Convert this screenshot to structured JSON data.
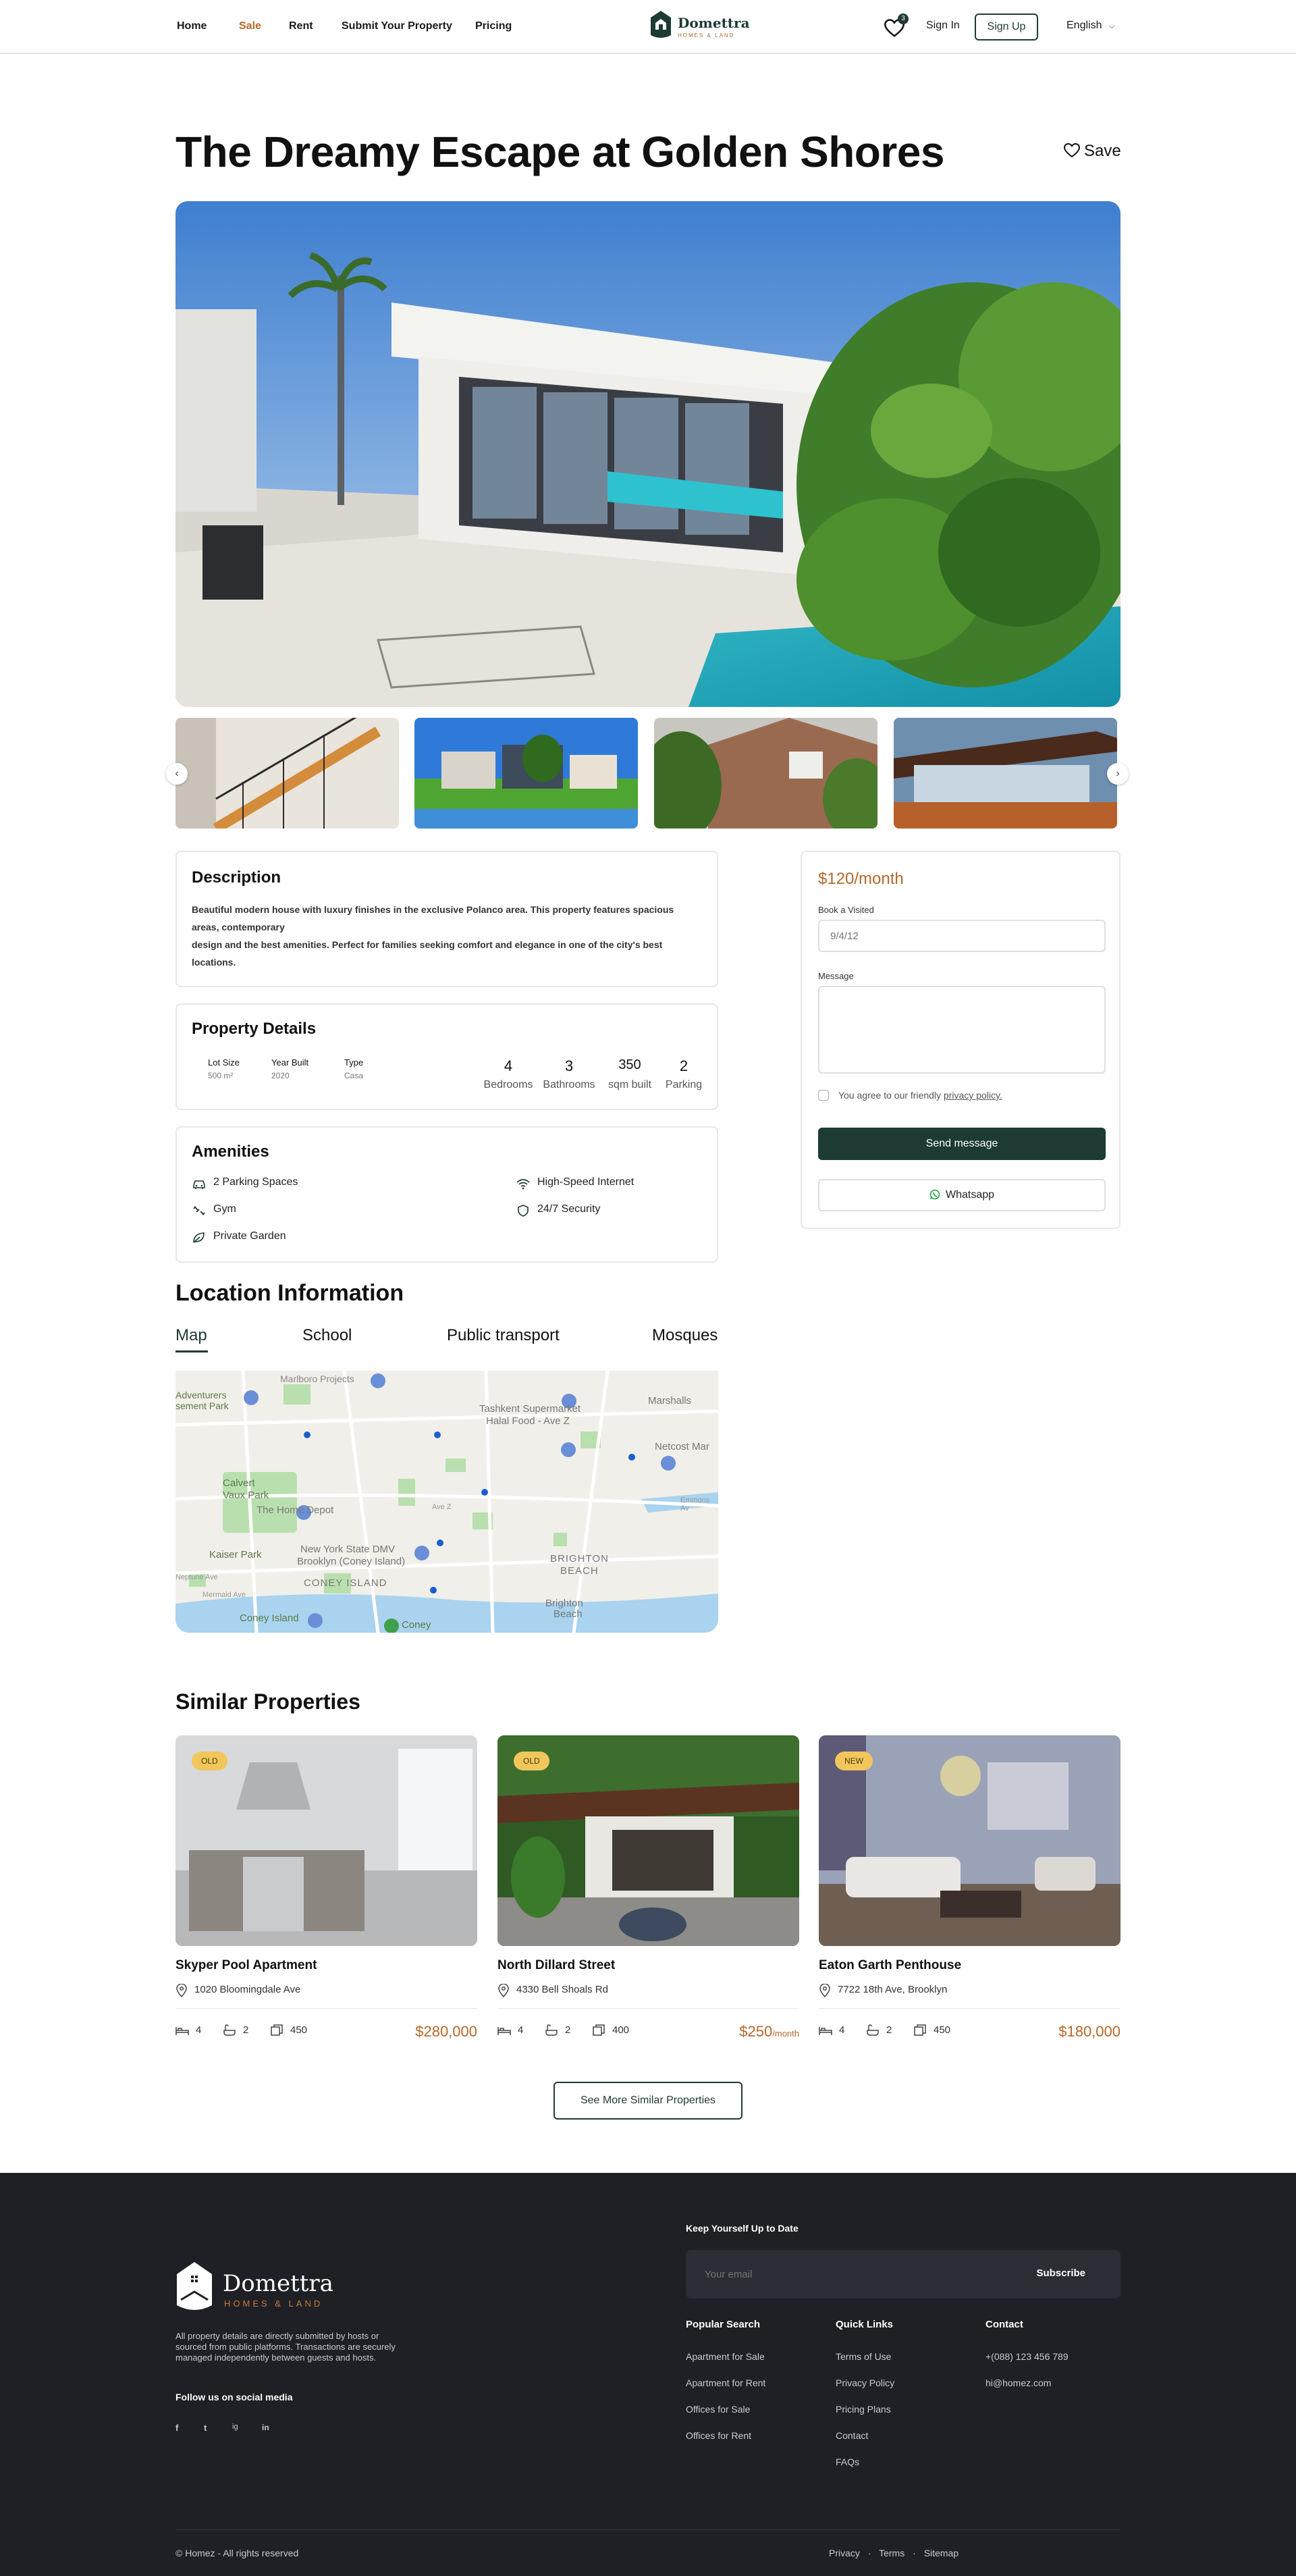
{
  "header": {
    "nav": [
      "Home",
      "Sale",
      "Rent",
      "Submit Your Property",
      "Pricing"
    ],
    "active_nav": "Sale",
    "logo_name": "Domettra",
    "logo_tagline": "HOMES & LAND",
    "wishlist_count": "3",
    "signin": "Sign In",
    "signup": "Sign Up",
    "language": "English"
  },
  "property": {
    "title": "The Dreamy Escape at Golden Shores",
    "save_label": "Save"
  },
  "description": {
    "heading": "Description",
    "lines": [
      "Beautiful modern house with luxury finishes in the exclusive Polanco area. This property features spacious",
      "areas, contemporary",
      "design and the best amenities. Perfect for families seeking comfort and elegance in one of the city's best",
      "locations."
    ]
  },
  "details": {
    "heading": "Property Details",
    "meta": [
      {
        "label": "Lot Size",
        "value": "500 m²"
      },
      {
        "label": "Year Built",
        "value": "2020"
      },
      {
        "label": "Type",
        "value": "Casa"
      }
    ],
    "stats": [
      {
        "num": "4",
        "unit": "Bedrooms"
      },
      {
        "num": "3",
        "unit": "Bathrooms"
      },
      {
        "num": "350",
        "unit": "sqm built"
      },
      {
        "num": "2",
        "unit": "Parking"
      }
    ]
  },
  "amenities": {
    "heading": "Amenities",
    "items": [
      {
        "label": "2 Parking Spaces",
        "icon": "car-icon"
      },
      {
        "label": "High-Speed Internet",
        "icon": "wifi-icon"
      },
      {
        "label": "Gym",
        "icon": "dumbbell-icon"
      },
      {
        "label": "24/7 Security",
        "icon": "shield-icon"
      },
      {
        "label": "Private Garden",
        "icon": "leaf-icon"
      }
    ]
  },
  "booking": {
    "price": "$120",
    "price_unit": "/month",
    "visit_label": "Book a Visited",
    "visit_placeholder": "9/4/12",
    "message_label": "Message",
    "agree_text": "You agree to our friendly ",
    "agree_link": "privacy policy.",
    "send": "Send message",
    "whatsapp": "Whatsapp"
  },
  "location": {
    "heading": "Location Information",
    "tabs": [
      "Map",
      "School",
      "Public transport",
      "Mosques"
    ],
    "active_tab": "Map",
    "map_labels": {
      "l1": "Adventurers",
      "l2": "sement Park",
      "l3": "Marlboro Projects",
      "l4": "Tashkent Supermarket",
      "l5": "Halal Food - Ave Z",
      "l6": "Marshalls",
      "l7": "Calvert",
      "l8": "Vaux Park",
      "l9": "The Home Depot",
      "l10": "Netcost Mar",
      "l11": "Kaiser Park",
      "l12": "New York State DMV",
      "l13": "Brooklyn (Coney Island)",
      "l14": "CONEY ISLAND",
      "l15": "BRIGHTON",
      "l16": "BEACH",
      "l17": "Coney Island",
      "l18": "Coney",
      "l19": "Brighton",
      "l20": "Beach",
      "l21": "Neptune Ave",
      "l22": "Mermaid Ave",
      "l23": "Ave Z",
      "l24": "Emmons Av"
    }
  },
  "similar": {
    "heading": "Similar Properties",
    "items": [
      {
        "tag": "OLD",
        "name": "Skyper Pool Apartment",
        "address": "1020 Bloomingdale Ave",
        "beds": "4",
        "baths": "2",
        "area": "450",
        "price": "$280,000",
        "price_unit": ""
      },
      {
        "tag": "OLD",
        "name": "North Dillard Street",
        "address": "4330 Bell Shoals Rd",
        "beds": "4",
        "baths": "2",
        "area": "400",
        "price": "$250",
        "price_unit": "/month"
      },
      {
        "tag": "NEW",
        "name": "Eaton Garth Penthouse",
        "address": "7722 18th Ave, Brooklyn",
        "beds": "4",
        "baths": "2",
        "area": "450",
        "price": "$180,000",
        "price_unit": ""
      }
    ],
    "see_more": "See More Similar Properties"
  },
  "footer": {
    "logo_name": "Domettra",
    "logo_tagline": "HOMES & LAND",
    "blurb": [
      "All property details are directly submitted by hosts or",
      "sourced from public platforms. Transactions are securely",
      "managed independently between guests and hosts."
    ],
    "social_heading": "Follow us on social media",
    "social": [
      "f",
      "t",
      "ig",
      "in"
    ],
    "newsletter_heading": "Keep Yourself Up to Date",
    "email_placeholder": "Your email",
    "subscribe": "Subscribe",
    "popular_heading": "Popular Search",
    "popular": [
      "Apartment for Sale",
      "Apartment for Rent",
      "Offices for Sale",
      "Offices for Rent"
    ],
    "quick_heading": "Quick Links",
    "quick": [
      "Terms of Use",
      "Privacy Policy",
      "Pricing Plans",
      "Contact",
      "FAQs"
    ],
    "contact_heading": "Contact",
    "contact": [
      "+(088) 123 456 789",
      "hi@homez.com"
    ],
    "copyright": "© Homez - All rights reserved",
    "bottom_links": [
      "Privacy",
      "Terms",
      "Sitemap"
    ],
    "sep": "·"
  },
  "colors": {
    "brand_green": "#1d3a34",
    "accent_orange": "#b5682c",
    "footer_bg": "#1f2026"
  }
}
